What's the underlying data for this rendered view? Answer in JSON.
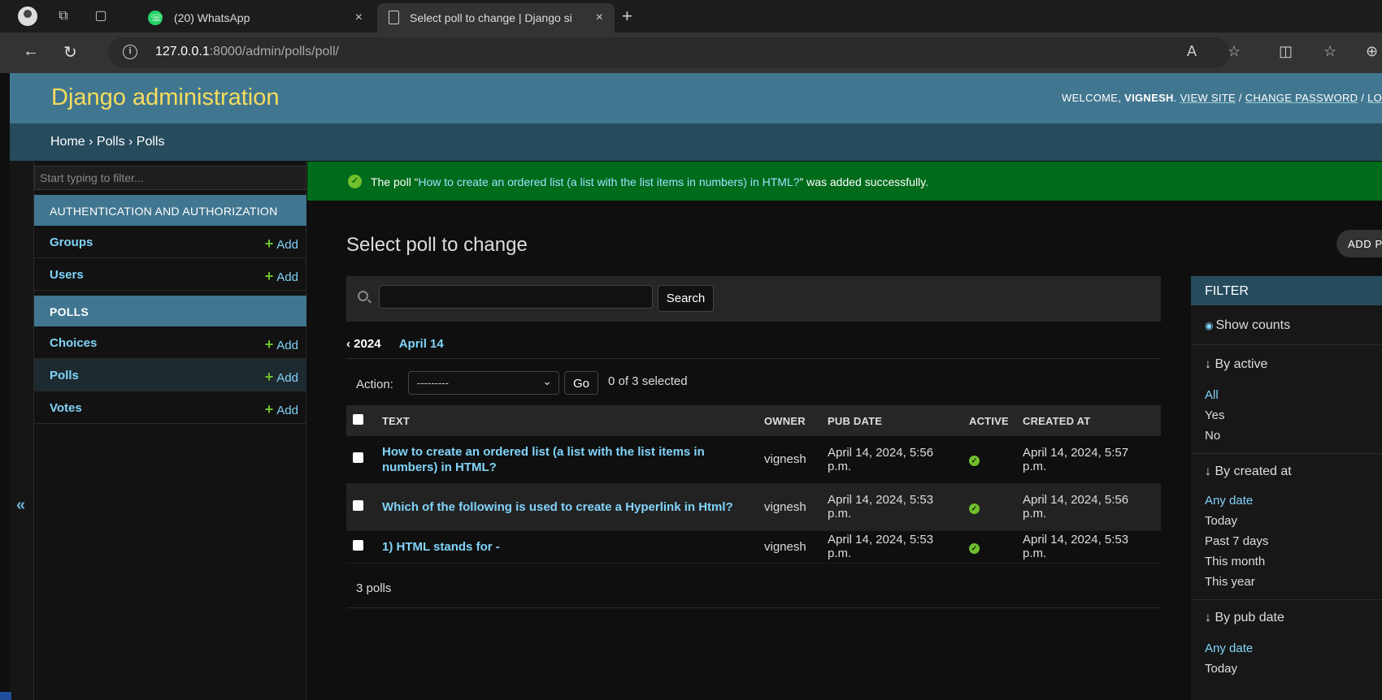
{
  "browser": {
    "tabs": [
      {
        "title": "(20) WhatsApp",
        "close": "×"
      },
      {
        "title": "Select poll to change | Django site admin",
        "close": "×"
      }
    ],
    "new_tab": "+",
    "url_host": "127.0.0.1",
    "url_rest": ":8000/admin/polls/poll/"
  },
  "header": {
    "brand": "Django administration",
    "welcome": "WELCOME,",
    "user": "VIGNESH",
    "view_site": "VIEW SITE",
    "change_password": "CHANGE PASSWORD",
    "logout": "LOG OUT",
    "slash": "/"
  },
  "breadcrumbs": "Home › Polls › Polls",
  "sidebar": {
    "filter_placeholder": "Start typing to filter...",
    "toggle": "«",
    "modules": [
      {
        "caption": "AUTHENTICATION AND AUTHORIZATION",
        "models": [
          {
            "name": "Groups",
            "add": "Add"
          },
          {
            "name": "Users",
            "add": "Add"
          }
        ]
      },
      {
        "caption": "POLLS",
        "models": [
          {
            "name": "Choices",
            "add": "Add"
          },
          {
            "name": "Polls",
            "add": "Add"
          },
          {
            "name": "Votes",
            "add": "Add"
          }
        ]
      }
    ]
  },
  "message": {
    "prefix": "The poll “",
    "poll": "How to create an ordered list (a list with the list items in numbers) in HTML?",
    "suffix": "” was added successfully."
  },
  "main": {
    "title": "Select poll to change",
    "add_button": "ADD POLL",
    "search_button": "Search",
    "date_back": "‹ 2024",
    "date_current": "April 14",
    "action_label": "Action:",
    "action_selected": "---------",
    "go": "Go",
    "selected_count": "0 of 3 selected",
    "columns": [
      "TEXT",
      "OWNER",
      "PUB DATE",
      "ACTIVE",
      "CREATED AT"
    ],
    "rows": [
      {
        "text": "How to create an ordered list (a list with the list items in numbers) in HTML?",
        "owner": "vignesh",
        "pub_date": "April 14, 2024, 5:56 p.m.",
        "active": true,
        "created_at": "April 14, 2024, 5:57 p.m."
      },
      {
        "text": "Which of the following is used to create a Hyperlink in Html?",
        "owner": "vignesh",
        "pub_date": "April 14, 2024, 5:53 p.m.",
        "active": true,
        "created_at": "April 14, 2024, 5:56 p.m."
      },
      {
        "text": "1) HTML stands for -",
        "owner": "vignesh",
        "pub_date": "April 14, 2024, 5:53 p.m.",
        "active": true,
        "created_at": "April 14, 2024, 5:53 p.m."
      }
    ],
    "paginator": "3 polls"
  },
  "filter": {
    "title": "FILTER",
    "show_counts": "Show counts",
    "groups": [
      {
        "title": "↓ By active",
        "choices": [
          "All",
          "Yes",
          "No"
        ],
        "selected": 0
      },
      {
        "title": "↓ By created at",
        "choices": [
          "Any date",
          "Today",
          "Past 7 days",
          "This month",
          "This year"
        ],
        "selected": 0
      },
      {
        "title": "↓ By pub date",
        "choices": [
          "Any date",
          "Today"
        ],
        "selected": 0
      }
    ]
  },
  "colors": {
    "header": "#417690",
    "breadcrumbs": "#264b5d",
    "brand": "#f5dd5d",
    "link": "#81d4fa",
    "success": "#006b1b"
  }
}
